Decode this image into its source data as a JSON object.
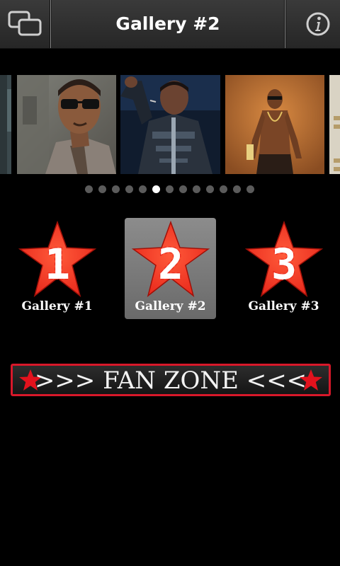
{
  "titlebar": {
    "title": "Gallery #2",
    "left_icon": "switch-windows-icon",
    "right_icon": "info-icon"
  },
  "photo_strip": {
    "photos": [
      {
        "name": "photo-partial-left"
      },
      {
        "name": "photo-sunglasses"
      },
      {
        "name": "photo-stage-jacket"
      },
      {
        "name": "photo-shirtless-orange"
      },
      {
        "name": "photo-partial-right"
      }
    ]
  },
  "pager": {
    "count": 13,
    "active_index": 5
  },
  "galleries": [
    {
      "number": "1",
      "label": "Gallery #1",
      "selected": false
    },
    {
      "number": "2",
      "label": "Gallery #2",
      "selected": true
    },
    {
      "number": "3",
      "label": "Gallery #3",
      "selected": false
    }
  ],
  "fan_zone": {
    "label": ">>> FAN ZONE <<<"
  },
  "colors": {
    "star_red": "#e8291c",
    "banner_border": "#d8182a",
    "selected_tile": "#7a7a7a"
  }
}
